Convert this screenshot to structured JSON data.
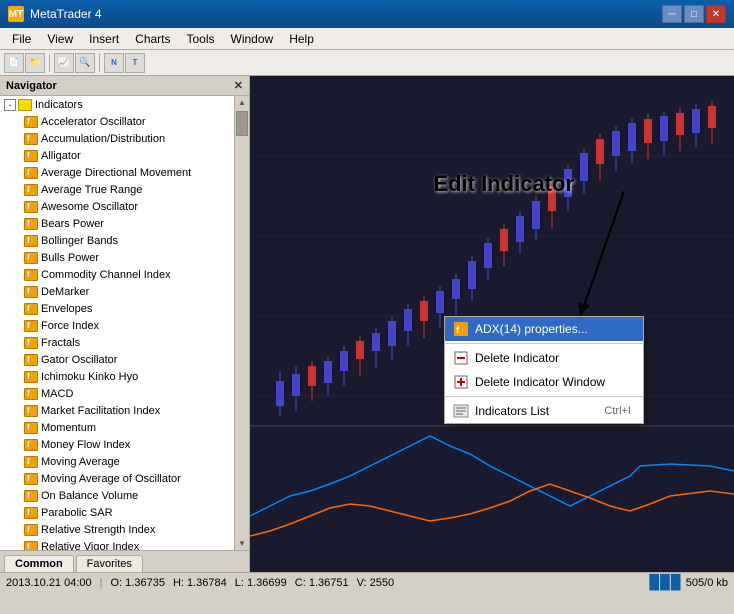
{
  "window": {
    "title": "MetaTrader 4",
    "title_icon": "MT"
  },
  "menu": {
    "items": [
      "File",
      "View",
      "Insert",
      "Charts",
      "Tools",
      "Window",
      "Help"
    ]
  },
  "navigator": {
    "title": "Navigator",
    "indicators_label": "Indicators",
    "expand_symbol": "-",
    "items": [
      "Accelerator Oscillator",
      "Accumulation/Distribution",
      "Alligator",
      "Average Directional Movement",
      "Average True Range",
      "Awesome Oscillator",
      "Bears Power",
      "Bollinger Bands",
      "Bulls Power",
      "Commodity Channel Index",
      "DeMarker",
      "Envelopes",
      "Force Index",
      "Fractals",
      "Gator Oscillator",
      "Ichimoku Kinko Hyo",
      "MACD",
      "Market Facilitation Index",
      "Momentum",
      "Money Flow Index",
      "Moving Average",
      "Moving Average of Oscillator",
      "On Balance Volume",
      "Parabolic SAR",
      "Relative Strength Index",
      "Relative Vigor Index"
    ]
  },
  "tabs": {
    "common": "Common",
    "favorites": "Favorites"
  },
  "context_menu": {
    "items": [
      {
        "label": "ADX(14) properties...",
        "shortcut": "",
        "highlighted": true
      },
      {
        "label": "Delete Indicator",
        "shortcut": ""
      },
      {
        "label": "Delete Indicator Window",
        "shortcut": ""
      },
      {
        "label": "Indicators List",
        "shortcut": "Ctrl+I"
      }
    ]
  },
  "edit_indicator_label": "Edit Indicator",
  "status_bar": {
    "date": "2013.10.21 04:00",
    "open": "O: 1.36735",
    "high": "H: 1.36784",
    "low": "L: 1.36699",
    "close": "C: 1.36751",
    "volume": "V: 2550",
    "file_size": "505/0 kb"
  }
}
